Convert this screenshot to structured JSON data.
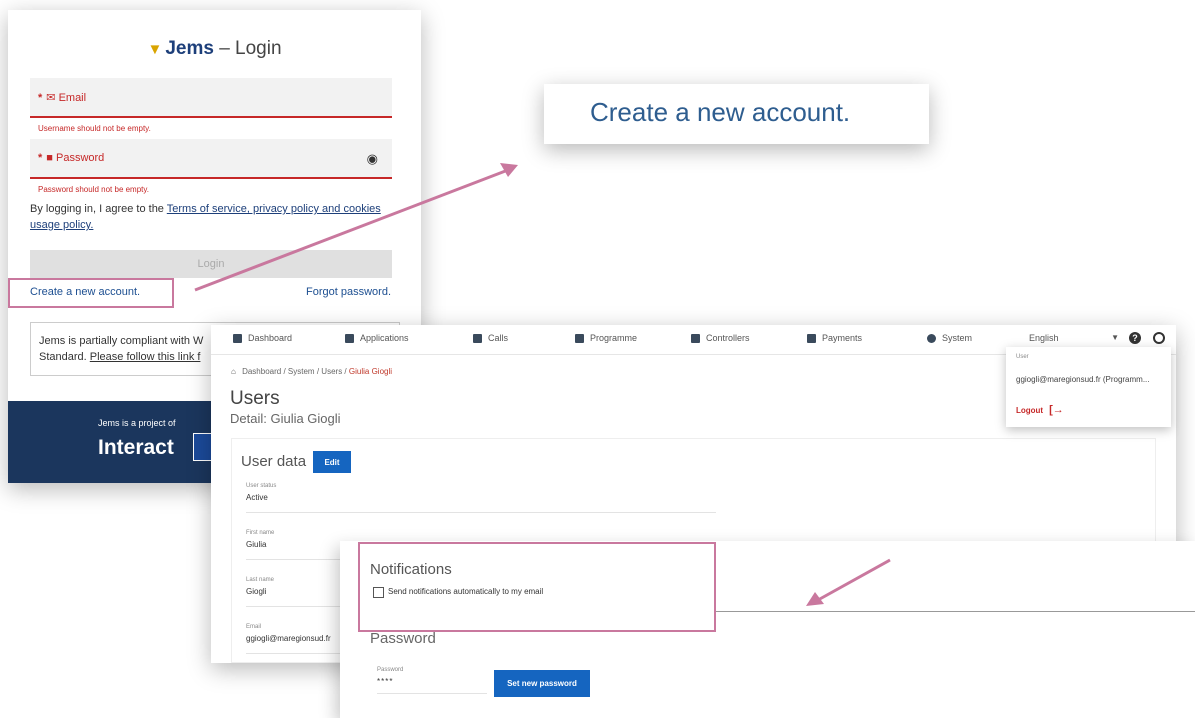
{
  "login": {
    "brand": "Jems",
    "title_suffix": "– Login",
    "email_label": "Email",
    "email_error": "Username should not be empty.",
    "password_label": "Password",
    "password_error": "Password should not be empty.",
    "terms_prefix": "By logging in, I agree to the ",
    "terms_link": "Terms of service, privacy policy and cookies usage policy.",
    "login_button": "Login",
    "create_account": "Create a new account.",
    "forgot_password": "Forgot password.",
    "compliance_line1": "Jems is partially compliant with W",
    "compliance_line2_prefix": "Standard. ",
    "compliance_link": "Please follow this link f",
    "footer_text": "Jems is a project of",
    "footer_logo": "Interact"
  },
  "zoom": {
    "text": "Create a new account."
  },
  "app": {
    "nav": {
      "dashboard": "Dashboard",
      "applications": "Applications",
      "calls": "Calls",
      "programme": "Programme",
      "controllers": "Controllers",
      "payments": "Payments",
      "system": "System",
      "language": "English"
    },
    "breadcrumb": {
      "dashboard": "Dashboard",
      "system": "System",
      "users": "Users",
      "current": "Giulia Giogli",
      "sep": "/"
    },
    "page_title": "Users",
    "page_subtitle": "Detail: Giulia Giogli",
    "user_data": {
      "title": "User data",
      "edit_button": "Edit",
      "fields": [
        {
          "label": "User status",
          "value": "Active"
        },
        {
          "label": "First name",
          "value": "Giulia"
        },
        {
          "label": "Last name",
          "value": "Giogli"
        },
        {
          "label": "Email",
          "value": "ggiogli@maregionsud.fr"
        }
      ]
    },
    "user_menu": {
      "label": "User",
      "email": "ggiogli@maregionsud.fr (Programm...",
      "logout": "Logout"
    }
  },
  "notifications": {
    "title": "Notifications",
    "checkbox_label": "Send notifications automatically to my email",
    "checked": false,
    "password_title": "Password",
    "password_label": "Password",
    "password_value": "****",
    "set_password_button": "Set new password"
  },
  "colors": {
    "annotation": "#c9789e",
    "primary_button": "#1565c0",
    "error": "#c62828",
    "footer": "#1b365d"
  }
}
